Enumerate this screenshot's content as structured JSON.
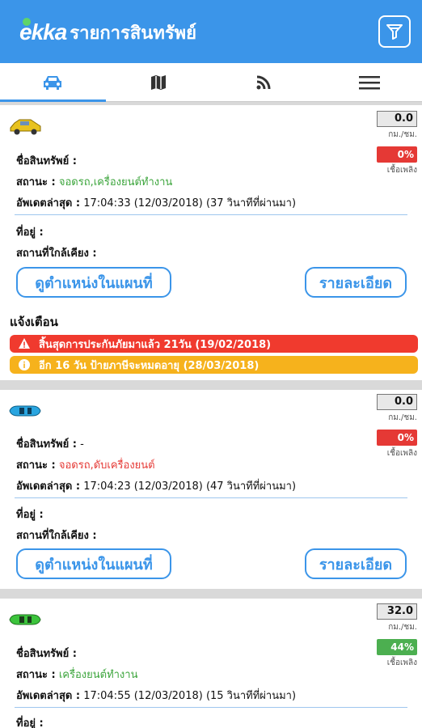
{
  "header": {
    "logo_text": "ekka",
    "title": "รายการสินทรัพย์"
  },
  "tabs": [
    {
      "name": "car-icon",
      "active": true
    },
    {
      "name": "map-icon",
      "active": false
    },
    {
      "name": "rss-icon",
      "active": false
    },
    {
      "name": "menu-icon",
      "active": false
    }
  ],
  "labels": {
    "asset_name": "ชื่อสินทรัพย์ :",
    "status": "สถานะ :",
    "last_update": "อัพเดตล่าสุด :",
    "address": "ที่อยู่ :",
    "nearby": "สถานที่ใกล้เคียง :",
    "speed_unit": "กม./ชม.",
    "fuel_unit": "เชื้อเพลิง",
    "map_button": "ดูตำแหน่งในแผนที่",
    "detail_button": "รายละเอียด",
    "alerts_title": "แจ้งเตือน"
  },
  "vehicles": [
    {
      "icon": "taxi-car-icon",
      "speed": "0.0",
      "fuel": "0%",
      "fuel_color": "#e53935",
      "asset_name": "",
      "status": "จอดรถ,เครื่องยนต์ทำงาน",
      "status_color": "#3ca53c",
      "last_update": "17:04:33 (12/03/2018) (37 วินาทีที่ผ่านมา)",
      "address": "",
      "nearby": "",
      "alerts": [
        {
          "type": "warning-icon",
          "text": "สิ้นสุดการประกันภัยมาแล้ว 21วัน (19/02/2018)",
          "color": "#f03a2e"
        },
        {
          "type": "info-icon",
          "text": "อีก 16 วัน ป้ายภาษีจะหมดอายุ (28/03/2018)",
          "color": "#f6b21c"
        }
      ]
    },
    {
      "icon": "blue-car-icon",
      "speed": "0.0",
      "fuel": "0%",
      "fuel_color": "#e53935",
      "asset_name": "-",
      "status": "จอดรถ,ดับเครื่องยนต์",
      "status_color": "#e53935",
      "last_update": "17:04:23 (12/03/2018) (47 วินาทีที่ผ่านมา)",
      "address": "",
      "nearby": ""
    },
    {
      "icon": "green-car-icon",
      "speed": "32.0",
      "fuel": "44%",
      "fuel_color": "#4caf50",
      "asset_name": "",
      "status": "เครื่องยนต์ทำงาน",
      "status_color": "#3ca53c",
      "last_update": "17:04:55 (12/03/2018) (15 วินาทีที่ผ่านมา)",
      "address": ""
    }
  ]
}
